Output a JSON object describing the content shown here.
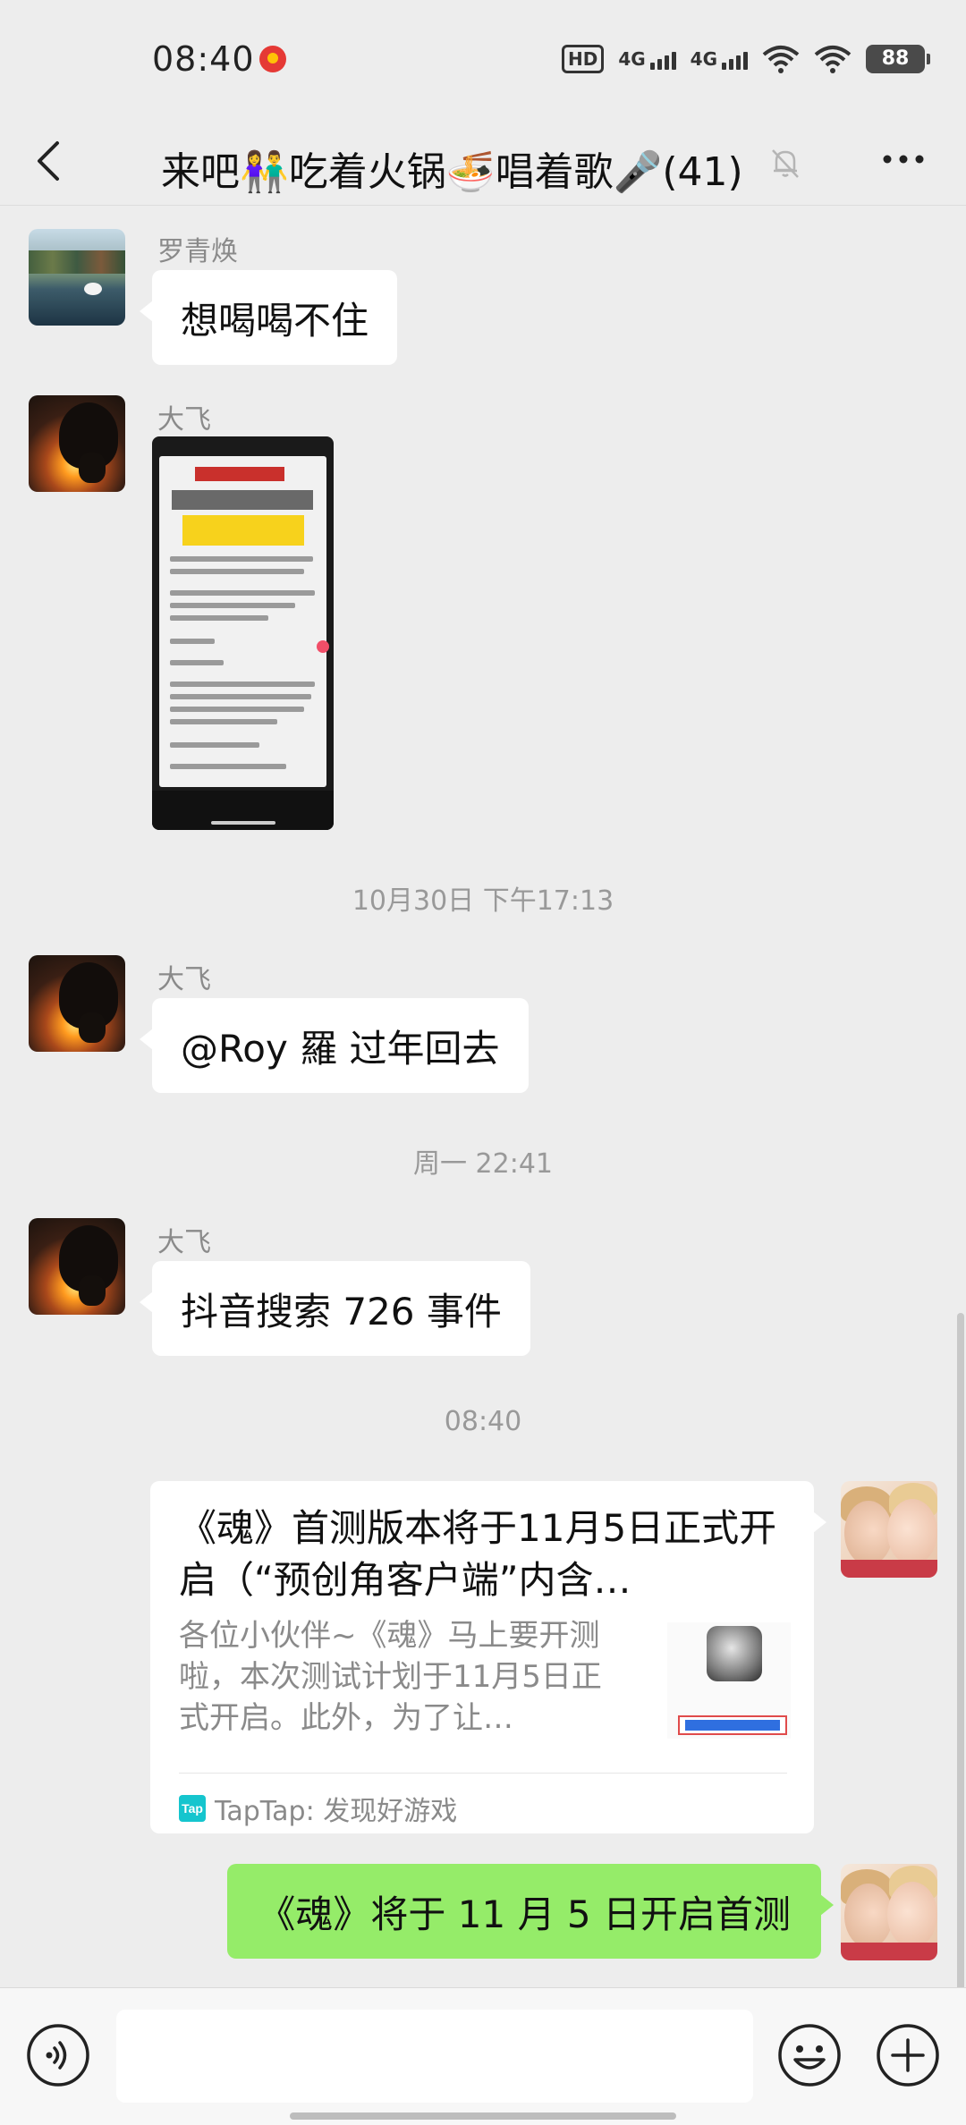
{
  "status_bar": {
    "time": "08:40",
    "hd_label": "HD",
    "network_1": "4G",
    "network_2": "4G",
    "battery": "88"
  },
  "header": {
    "title": "来吧👫吃着火锅🍜唱着歌🎤(41)",
    "icons": [
      "back-arrow-icon",
      "mute-bell-icon",
      "more-icon"
    ]
  },
  "messages": {
    "m1": {
      "sender": "罗青焕",
      "text": "想喝喝不住"
    },
    "m2": {
      "sender": "大飞",
      "type": "image"
    },
    "ts1": "10月30日 下午17:13",
    "m3": {
      "sender": "大飞",
      "text": "@Roy 羅  过年回去"
    },
    "ts2": "周一 22:41",
    "m4": {
      "sender": "大飞",
      "text": "抖音搜索 726 事件"
    },
    "ts3": "08:40",
    "card": {
      "title": "《魂》首测版本将于11月5日正式开启（“预创角客户端”内含…",
      "description": "各位小伙伴~《魂》马上要开测啦，本次测试计划于11月5日正式开启。此外，为了让…",
      "source_icon_text": "Tap",
      "source": "TapTap: 发现好游戏"
    },
    "m5": {
      "text": "《魂》将于 11 月 5 日开启首测"
    }
  },
  "input_bar": {
    "placeholder": "",
    "icons": [
      "voice-icon",
      "emoji-icon",
      "plus-icon"
    ]
  },
  "colors": {
    "background": "#ededed",
    "own_bubble": "#95ec69",
    "other_bubble": "#ffffff",
    "timestamp": "#999999"
  }
}
